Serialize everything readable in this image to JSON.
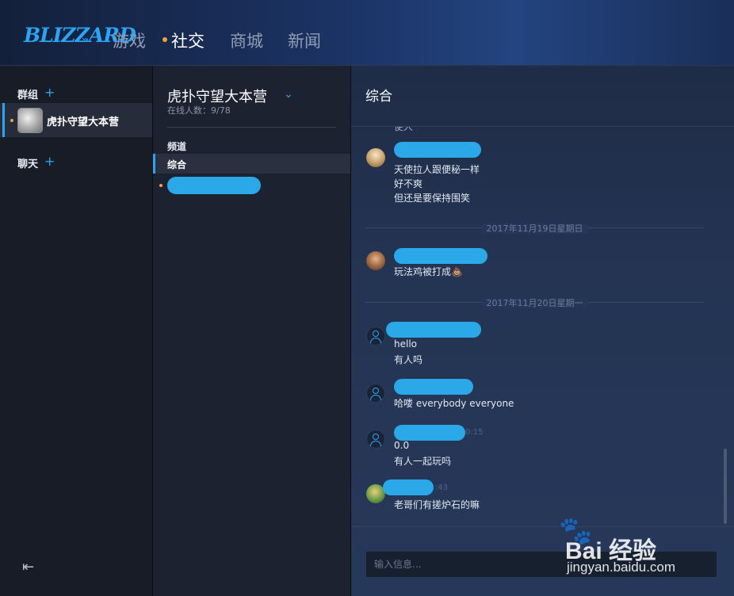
{
  "app": {
    "logo": "BLIZZARD",
    "nav": [
      {
        "label": "游戏"
      },
      {
        "label": "社交"
      },
      {
        "label": "商城"
      },
      {
        "label": "新闻"
      }
    ]
  },
  "sidebar": {
    "groups_label": "群组",
    "groups": [
      {
        "name": "虎扑守望大本营"
      }
    ],
    "chat_label": "聊天"
  },
  "group": {
    "title": "虎扑守望大本营",
    "online": "在线人数：9/78",
    "channels_label": "频道",
    "channels": [
      {
        "name": "综合"
      }
    ]
  },
  "chat": {
    "title": "综合",
    "partial_top": "使人",
    "messages": [
      {
        "lines": [
          "天使拉人跟便秘一样",
          "好不爽",
          "但还是要保持围笑"
        ]
      },
      {
        "lines": [
          "玩法鸡被打成💩"
        ]
      },
      {
        "lines": [
          "hello",
          "有人吗"
        ]
      },
      {
        "lines": [
          "哈喽 everybody everyone"
        ]
      },
      {
        "lines": [
          "0.0",
          "有人一起玩吗"
        ],
        "time": "0:15"
      },
      {
        "lines": [
          "老哥们有搓炉石的嘛"
        ],
        "time": ":43"
      }
    ],
    "date_separators": [
      "2017年11月19日星期日",
      "2017年11月20日星期一"
    ],
    "input_placeholder": "输入信息..."
  },
  "watermark": {
    "brand": "Bai 经验",
    "url": "jingyan.baidu.com"
  },
  "colors": {
    "accent": "#2aa4f5",
    "notify": "#f7a234"
  }
}
